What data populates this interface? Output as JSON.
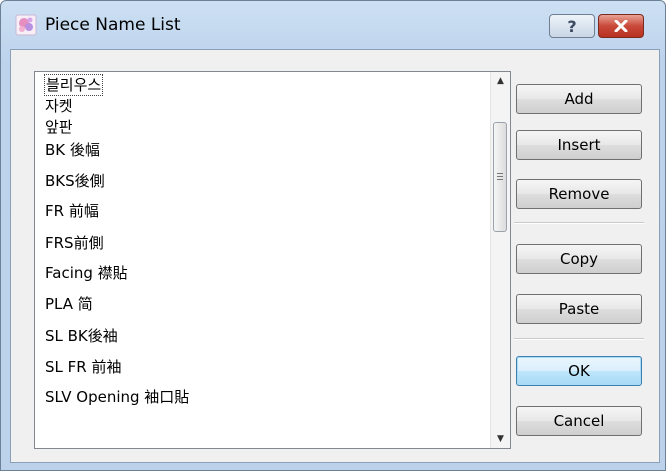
{
  "window": {
    "title": "Piece Name List"
  },
  "titlebar_buttons": {
    "help": "?",
    "close_icon": "close-x-icon"
  },
  "list": {
    "selected_index": 0,
    "items": [
      "블리우스",
      "자켓",
      "앞판",
      "BK 後幅",
      "BKS後側",
      "FR 前幅",
      "FRS前側",
      "Facing 襟貼",
      "PLA 简",
      "SL BK後袖",
      "SL FR 前袖",
      "SLV Opening 袖口貼"
    ]
  },
  "buttons": {
    "add": "Add",
    "insert": "Insert",
    "remove": "Remove",
    "copy": "Copy",
    "paste": "Paste",
    "ok": "OK",
    "cancel": "Cancel"
  }
}
